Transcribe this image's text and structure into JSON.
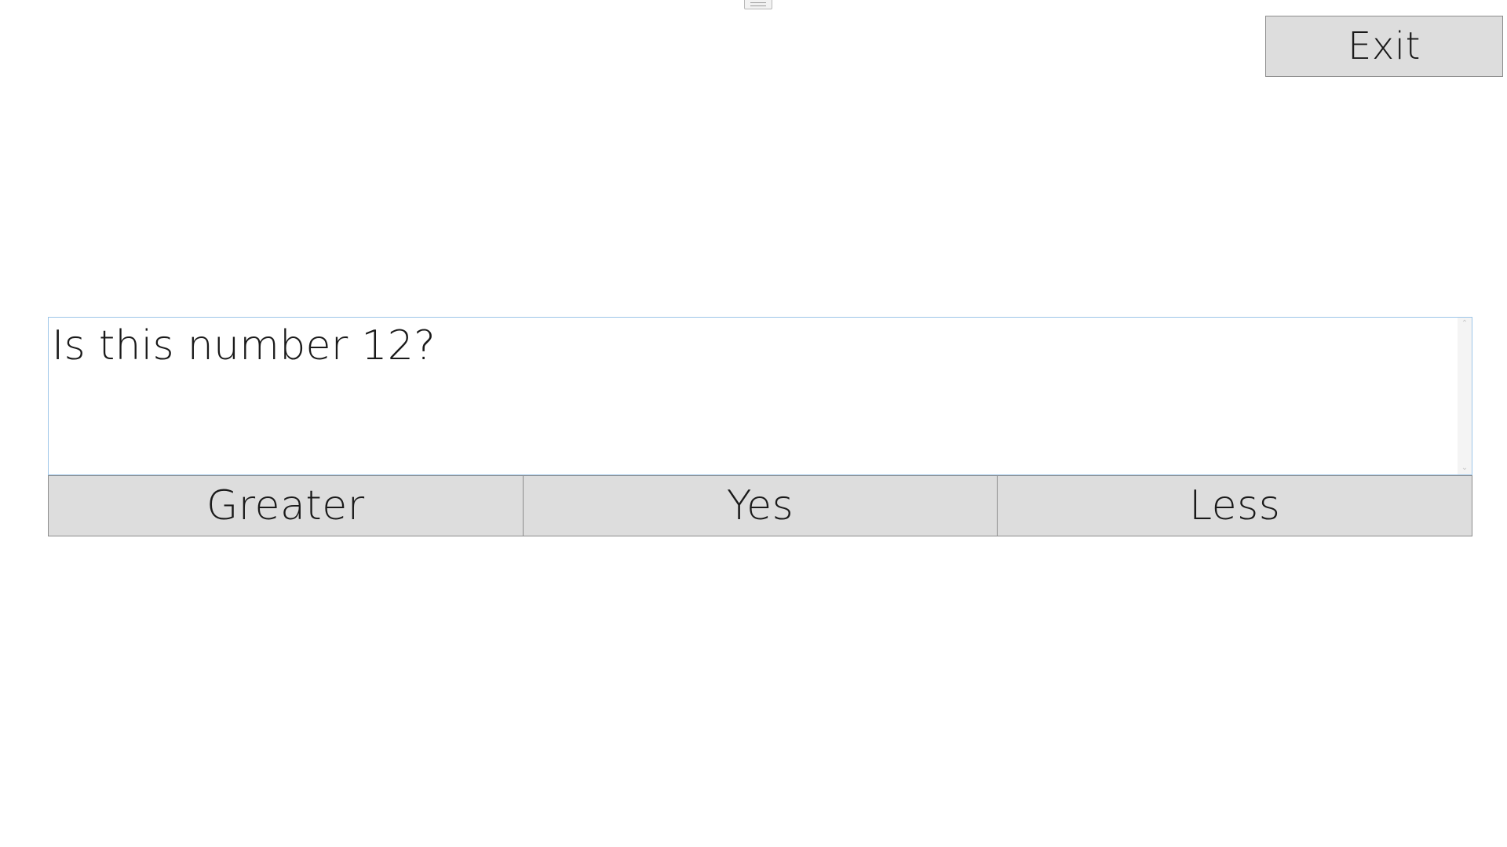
{
  "window": {
    "grip_icon": "drag-handle-icon"
  },
  "header": {
    "exit_label": "Exit"
  },
  "question": {
    "text": "Is this number 12?",
    "scroll_up_icon": "chevron-up-icon",
    "scroll_down_icon": "chevron-down-icon"
  },
  "answers": {
    "greater_label": "Greater",
    "yes_label": "Yes",
    "less_label": "Less"
  },
  "colors": {
    "button_bg": "#dddddd",
    "button_border": "#8c8c8c",
    "textbox_border": "#9cc5e8",
    "background": "#ffffff"
  }
}
